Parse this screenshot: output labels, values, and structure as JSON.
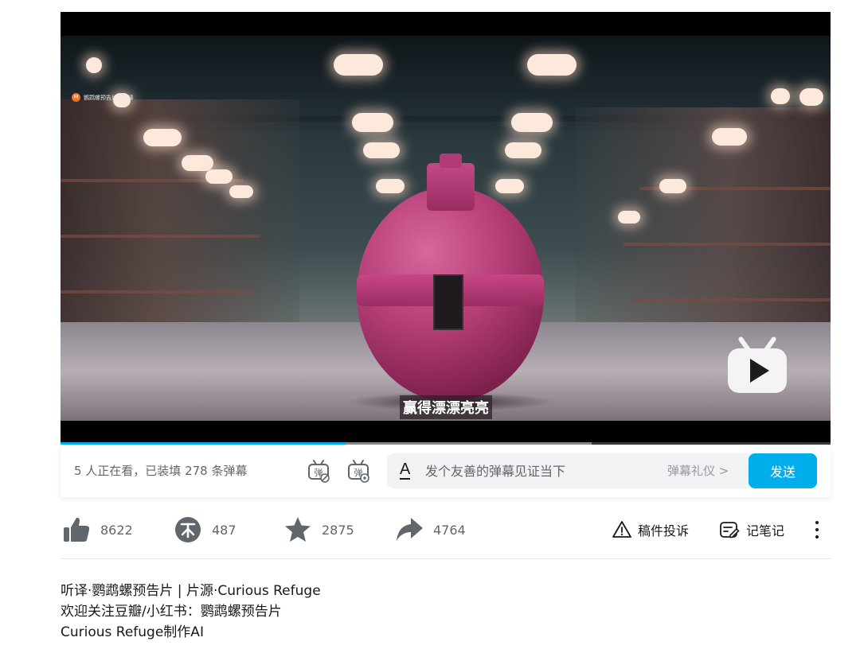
{
  "video": {
    "watermark_text": "鹦鹉螺预告片 · 翻译",
    "subtitle": "赢得漂漂亮亮",
    "progress": 0.37,
    "buffered": 0.69
  },
  "danmaku": {
    "viewers": "5 人正在看，已装填 278 条弹幕",
    "placeholder": "发个友善的弹幕见证当下",
    "etiquette": "弹幕礼仪 >",
    "send": "发送",
    "style_icon": "A"
  },
  "stats": {
    "likes": "8622",
    "coins": "487",
    "favorites": "2875",
    "shares": "4764"
  },
  "actions": {
    "report": "稿件投诉",
    "note": "记笔记"
  },
  "description": [
    "听译·鹦鹉螺预告片 | 片源·Curious Refuge",
    "欢迎关注豆瓣/小红书：鹦鹉螺预告片",
    "Curious Refuge制作AI"
  ],
  "colors": {
    "accent": "#00aeec",
    "icon": "#61666d",
    "text": "#18191c"
  }
}
